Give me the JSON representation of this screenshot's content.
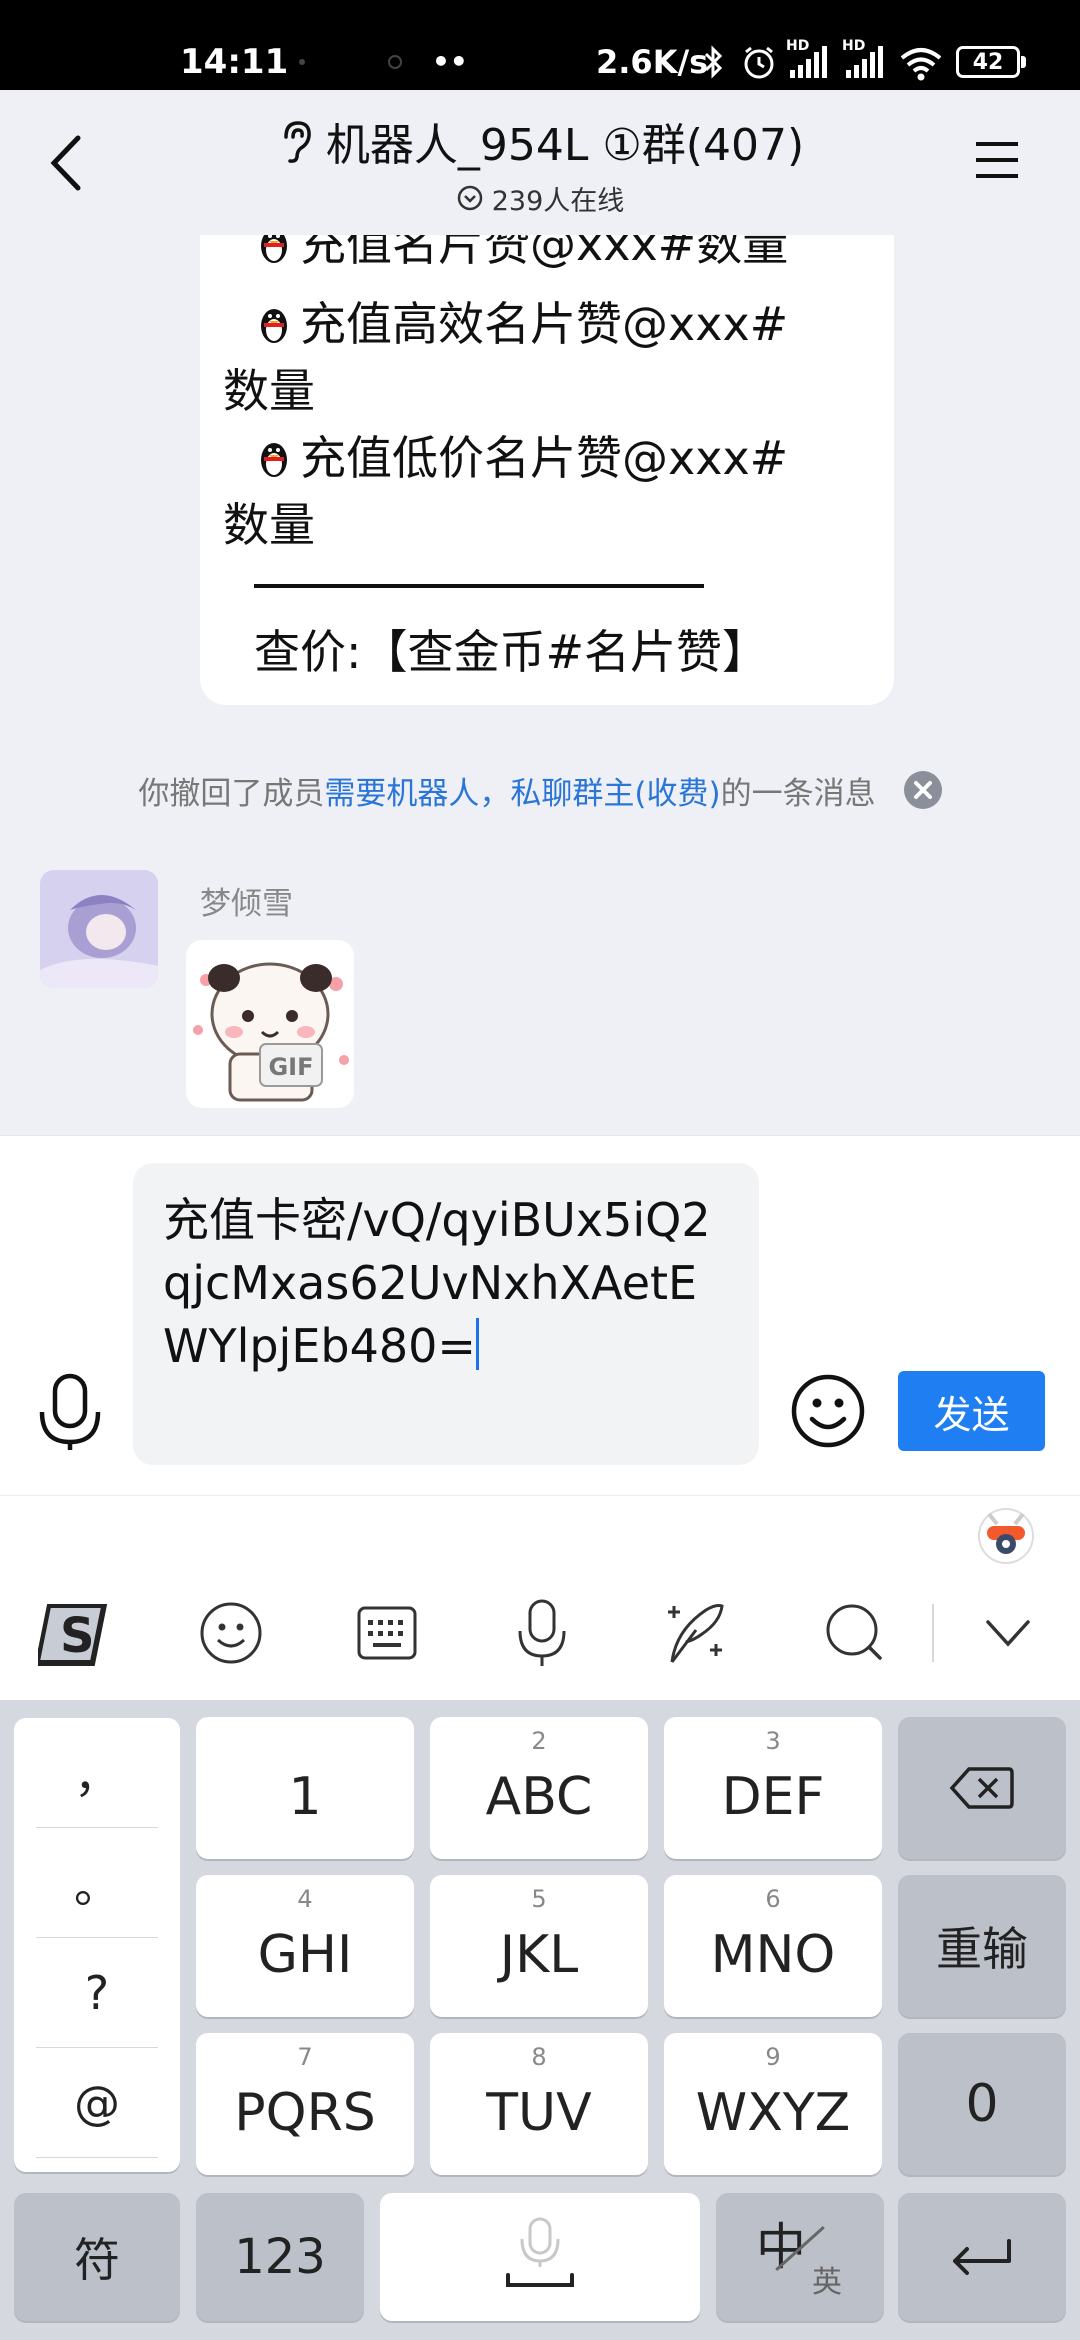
{
  "status_bar": {
    "time": "14:11",
    "dots": "••",
    "net_speed": "2.6K/s",
    "signal_tag_1": "HD",
    "signal_tag_2": "HD",
    "battery": "42"
  },
  "header": {
    "title": "机器人_954L ①群(407)",
    "subtitle": "239人在线"
  },
  "bubble_top": {
    "lines": [
      "充值名片赞@xxx#数量",
      "充值高效名片赞@xxx#",
      "数量",
      "充值低价名片赞@xxx#",
      "数量",
      "查价:【查金币#名片赞】"
    ]
  },
  "recall_notice": {
    "prefix": "你撤回了成员",
    "member": "需要机器人，私聊群主(收费)",
    "suffix": "的一条消息"
  },
  "message": {
    "sender": "梦倾雪",
    "sticker_badge": "GIF"
  },
  "composer": {
    "input_text": "充值卡密/vQ/qyiBUx5iQ2qjcMxas62UvNxhXAetEWYlpjEb480=",
    "send_label": "发送"
  },
  "keyboard": {
    "punct": [
      "，",
      "。",
      "?",
      "@"
    ],
    "keys": [
      {
        "sub": "",
        "main": "1"
      },
      {
        "sub": "2",
        "main": "ABC"
      },
      {
        "sub": "3",
        "main": "DEF"
      },
      {
        "sub": "4",
        "main": "GHI"
      },
      {
        "sub": "5",
        "main": "JKL"
      },
      {
        "sub": "6",
        "main": "MNO"
      },
      {
        "sub": "7",
        "main": "PQRS"
      },
      {
        "sub": "8",
        "main": "TUV"
      },
      {
        "sub": "9",
        "main": "WXYZ"
      }
    ],
    "reenter": "重输",
    "zero": "0",
    "symbols": "符",
    "numbers": "123",
    "lang_main": "中",
    "lang_sub": "英"
  }
}
